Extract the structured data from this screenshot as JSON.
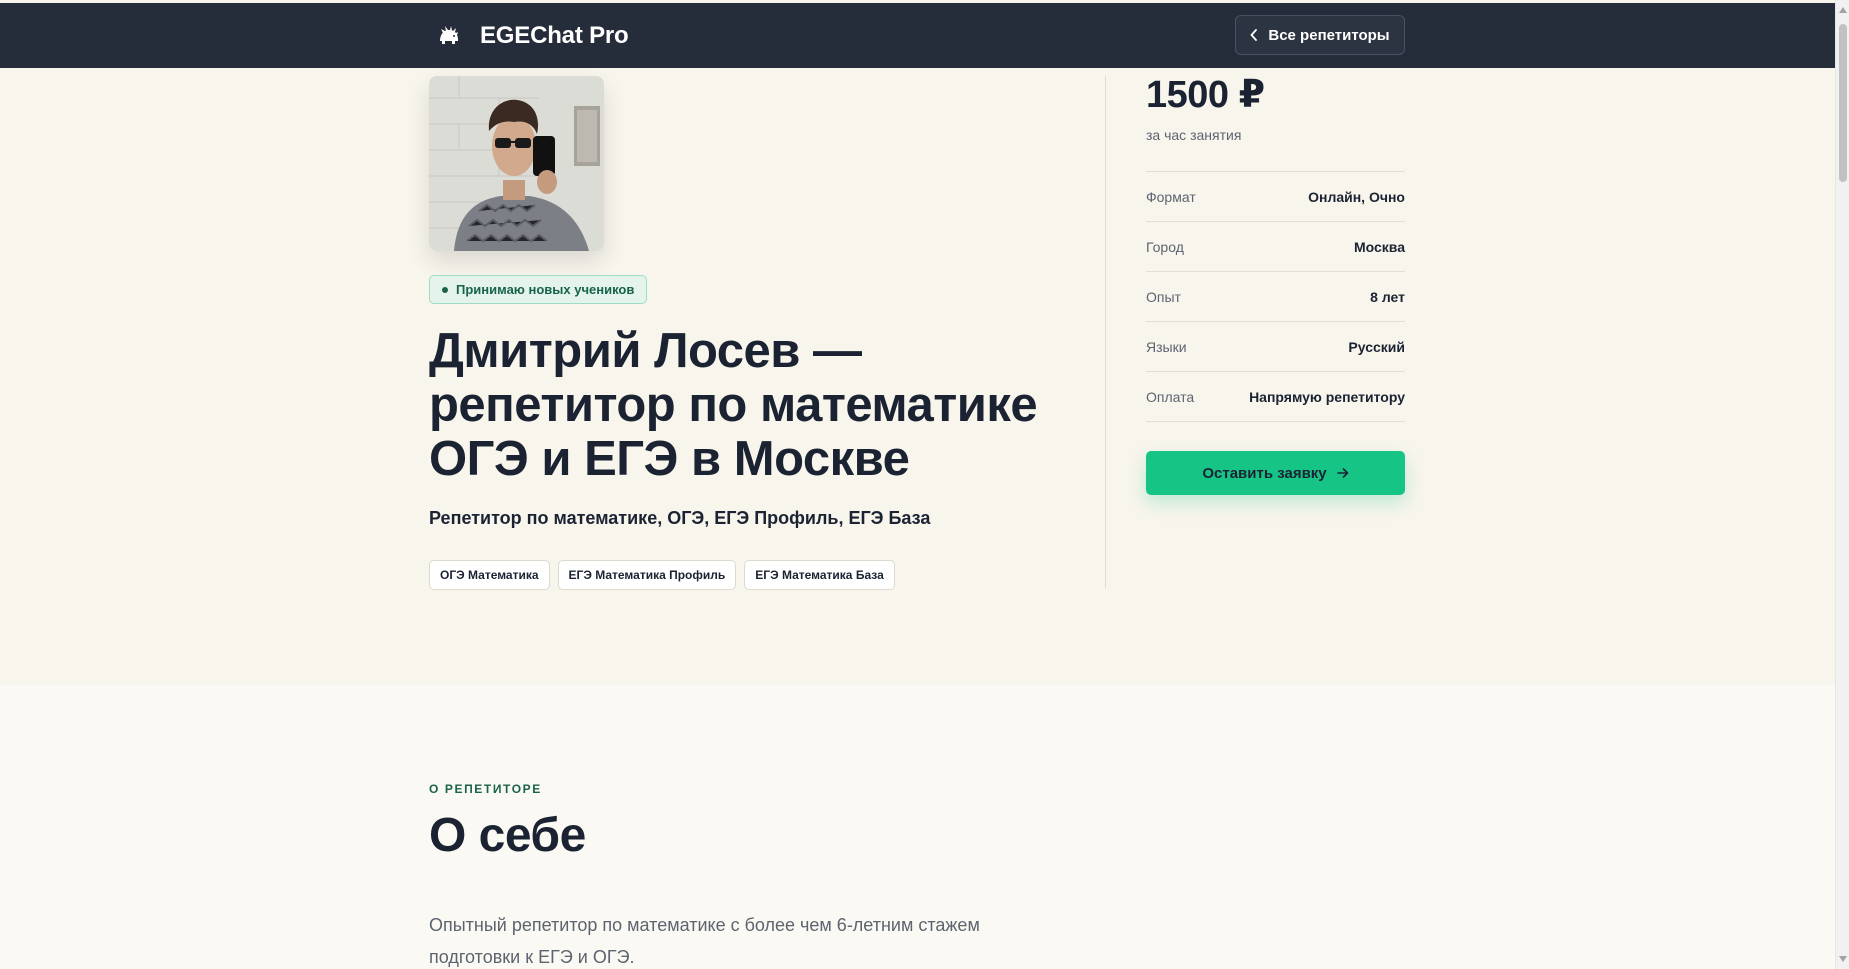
{
  "header": {
    "brand_name": "EGEChat Pro",
    "back_button_label": "Все репетиторы"
  },
  "hero": {
    "status_badge": "Принимаю новых учеников",
    "title": "Дмитрий Лосев — репетитор по математике ОГЭ и ЕГЭ в Москве",
    "subtitle": "Репетитор по математике, ОГЭ, ЕГЭ Профиль, ЕГЭ База",
    "tags": [
      "ОГЭ Математика",
      "ЕГЭ Математика Профиль",
      "ЕГЭ Математика База"
    ]
  },
  "sidebar": {
    "price": "1500 ₽",
    "price_note": "за час занятия",
    "info": [
      {
        "label": "Формат",
        "value": "Онлайн, Очно"
      },
      {
        "label": "Город",
        "value": "Москва"
      },
      {
        "label": "Опыт",
        "value": "8 лет"
      },
      {
        "label": "Языки",
        "value": "Русский"
      },
      {
        "label": "Оплата",
        "value": "Напрямую репетитору"
      }
    ],
    "cta_label": "Оставить заявку"
  },
  "about": {
    "eyebrow": "О РЕПЕТИТОРЕ",
    "title": "О себе",
    "text": "Опытный репетитор по математике с более чем 6-летним стажем подготовки к ЕГЭ и ОГЭ."
  },
  "colors": {
    "header_bg": "#262d3a",
    "page_bg": "#f8f5ed",
    "accent_green": "#16c486",
    "status_green": "#18634a",
    "text_dark": "#1b2333"
  },
  "icons": {
    "brand": "hedgehog-logo-icon",
    "back": "chevron-left-icon",
    "cta": "arrow-right-icon"
  }
}
